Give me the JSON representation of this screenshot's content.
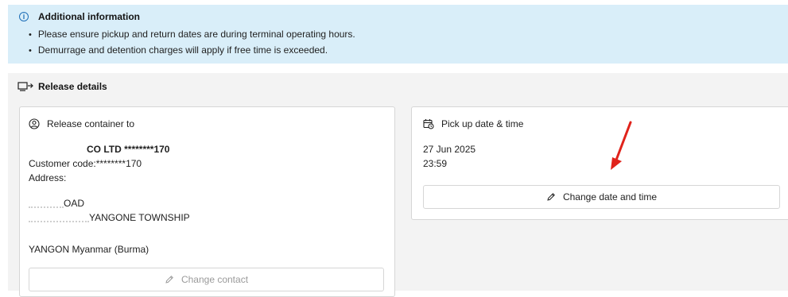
{
  "info": {
    "title": "Additional information",
    "bullets": [
      "Please ensure pickup and return dates are during terminal operating hours.",
      "Demurrage and detention charges will apply if free time is exceeded."
    ]
  },
  "release": {
    "title": "Release details",
    "contact_card": {
      "heading": "Release container to",
      "company": "CO LTD ********170",
      "customer_code": "Customer code:********170",
      "address_label": "Address:",
      "address_line1": "OAD",
      "address_line2": "YANGONE TOWNSHIP",
      "address_city": "YANGON Myanmar (Burma)",
      "change_button": "Change contact"
    },
    "pickup_card": {
      "heading": "Pick up date & time",
      "date": "27 Jun 2025",
      "time": "23:59",
      "change_button": "Change date and time"
    }
  },
  "colors": {
    "info_bg": "#d9eef9",
    "info_icon": "#1f6fb8",
    "section_bg": "#f3f3f3",
    "annotation_arrow": "#e0231b"
  }
}
